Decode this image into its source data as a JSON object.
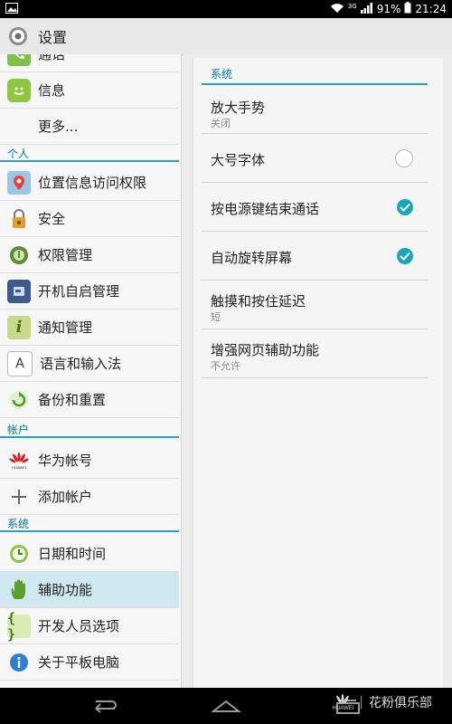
{
  "status": {
    "network": "3G",
    "battery": "91%",
    "time": "21:24"
  },
  "header": {
    "title": "设置"
  },
  "left_list": {
    "partial_item": "通话",
    "items_top": [
      {
        "label": "信息"
      },
      {
        "label": "更多..."
      }
    ],
    "section_personal": "个人",
    "items_personal": [
      {
        "label": "位置信息访问权限"
      },
      {
        "label": "安全"
      },
      {
        "label": "权限管理"
      },
      {
        "label": "开机自启管理"
      },
      {
        "label": "通知管理"
      },
      {
        "label": "语言和输入法"
      },
      {
        "label": "备份和重置"
      }
    ],
    "section_accounts": "帐户",
    "items_accounts": [
      {
        "label": "华为帐号"
      },
      {
        "label": "添加帐户"
      }
    ],
    "section_system": "系统",
    "items_system": [
      {
        "label": "日期和时间"
      },
      {
        "label": "辅助功能"
      },
      {
        "label": "开发人员选项"
      },
      {
        "label": "关于平板电脑"
      }
    ]
  },
  "right_panel": {
    "section": "系统",
    "items": [
      {
        "title": "放大手势",
        "subtitle": "关闭"
      },
      {
        "title": "大号字体",
        "checked": false
      },
      {
        "title": "按电源键结束通话",
        "checked": true
      },
      {
        "title": "自动旋转屏幕",
        "checked": true
      },
      {
        "title": "触摸和按住延迟",
        "subtitle": "短"
      },
      {
        "title": "增强网页辅助功能",
        "subtitle": "不允许"
      }
    ]
  },
  "navbar": {
    "watermark_brand": "HUAWEI",
    "watermark_text": "花粉俱乐部"
  },
  "colors": {
    "accent": "#2aa0c4",
    "selected": "#cfe7ef",
    "check": "#1aa7b7"
  }
}
